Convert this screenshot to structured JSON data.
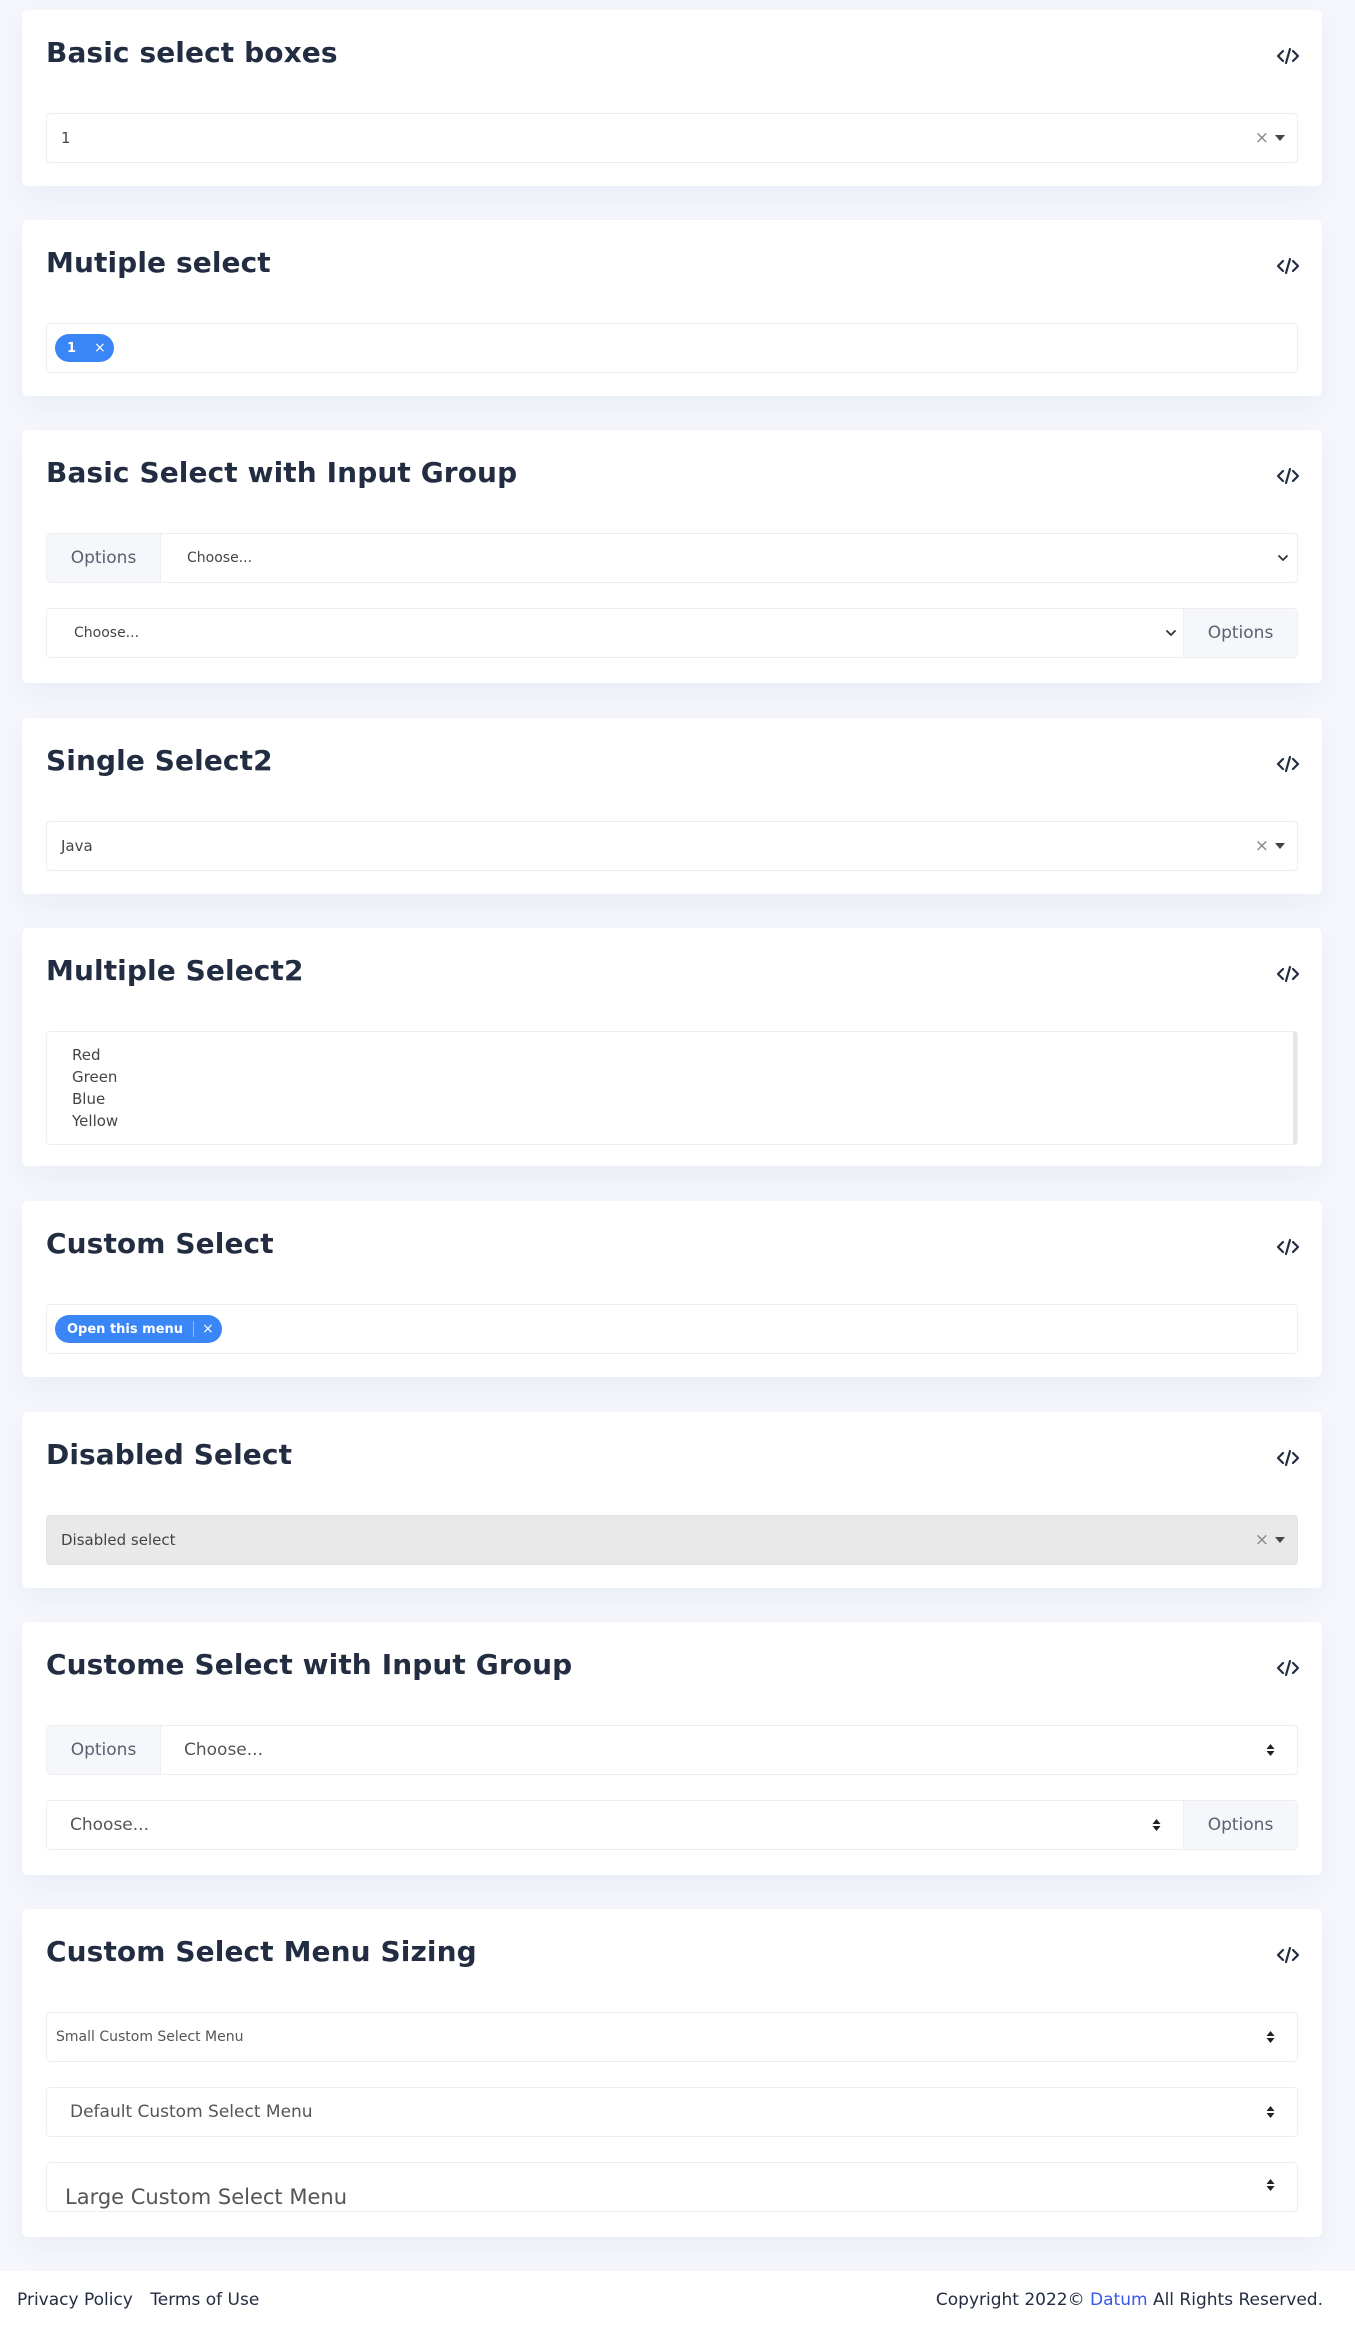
{
  "sections": {
    "basic_select": {
      "title": "Basic select boxes",
      "value": "1",
      "clear": "×"
    },
    "multiple_select": {
      "title": "Mutiple select",
      "tag": "1",
      "tag_remove": "×"
    },
    "basic_input_group": {
      "title": "Basic Select with Input Group",
      "row1_addon": "Options",
      "row1_value": "Choose...",
      "row2_value": "Choose...",
      "row2_addon": "Options"
    },
    "single_select2": {
      "title": "Single Select2",
      "value": "Java",
      "clear": "×"
    },
    "multiple_select2": {
      "title": "Multiple Select2",
      "options": [
        "Red",
        "Green",
        "Blue",
        "Yellow"
      ]
    },
    "custom_select": {
      "title": "Custom Select",
      "tag": "Open this menu",
      "tag_remove": "×"
    },
    "disabled_select": {
      "title": "Disabled Select",
      "value": "Disabled select",
      "clear": "×"
    },
    "custom_input_group": {
      "title": "Custome Select with Input Group",
      "row1_addon": "Options",
      "row1_value": "Choose...",
      "row2_value": "Choose...",
      "row2_addon": "Options"
    },
    "menu_sizing": {
      "title": "Custom Select Menu Sizing",
      "small": "Small Custom Select Menu",
      "default": "Default Custom Select Menu",
      "large": "Large Custom Select Menu"
    }
  },
  "code_icon": "code-icon",
  "footer": {
    "privacy": "Privacy Policy",
    "terms": "Terms of Use",
    "copyright_prefix": "Copyright 2022©",
    "brand": "Datum",
    "copyright_suffix": "All Rights Reserved."
  },
  "colors": {
    "accent": "#3a86f7",
    "brand_link": "#3a57e8",
    "page_bg": "#f5f7fc",
    "disabled_bg": "#e9e9e9"
  }
}
